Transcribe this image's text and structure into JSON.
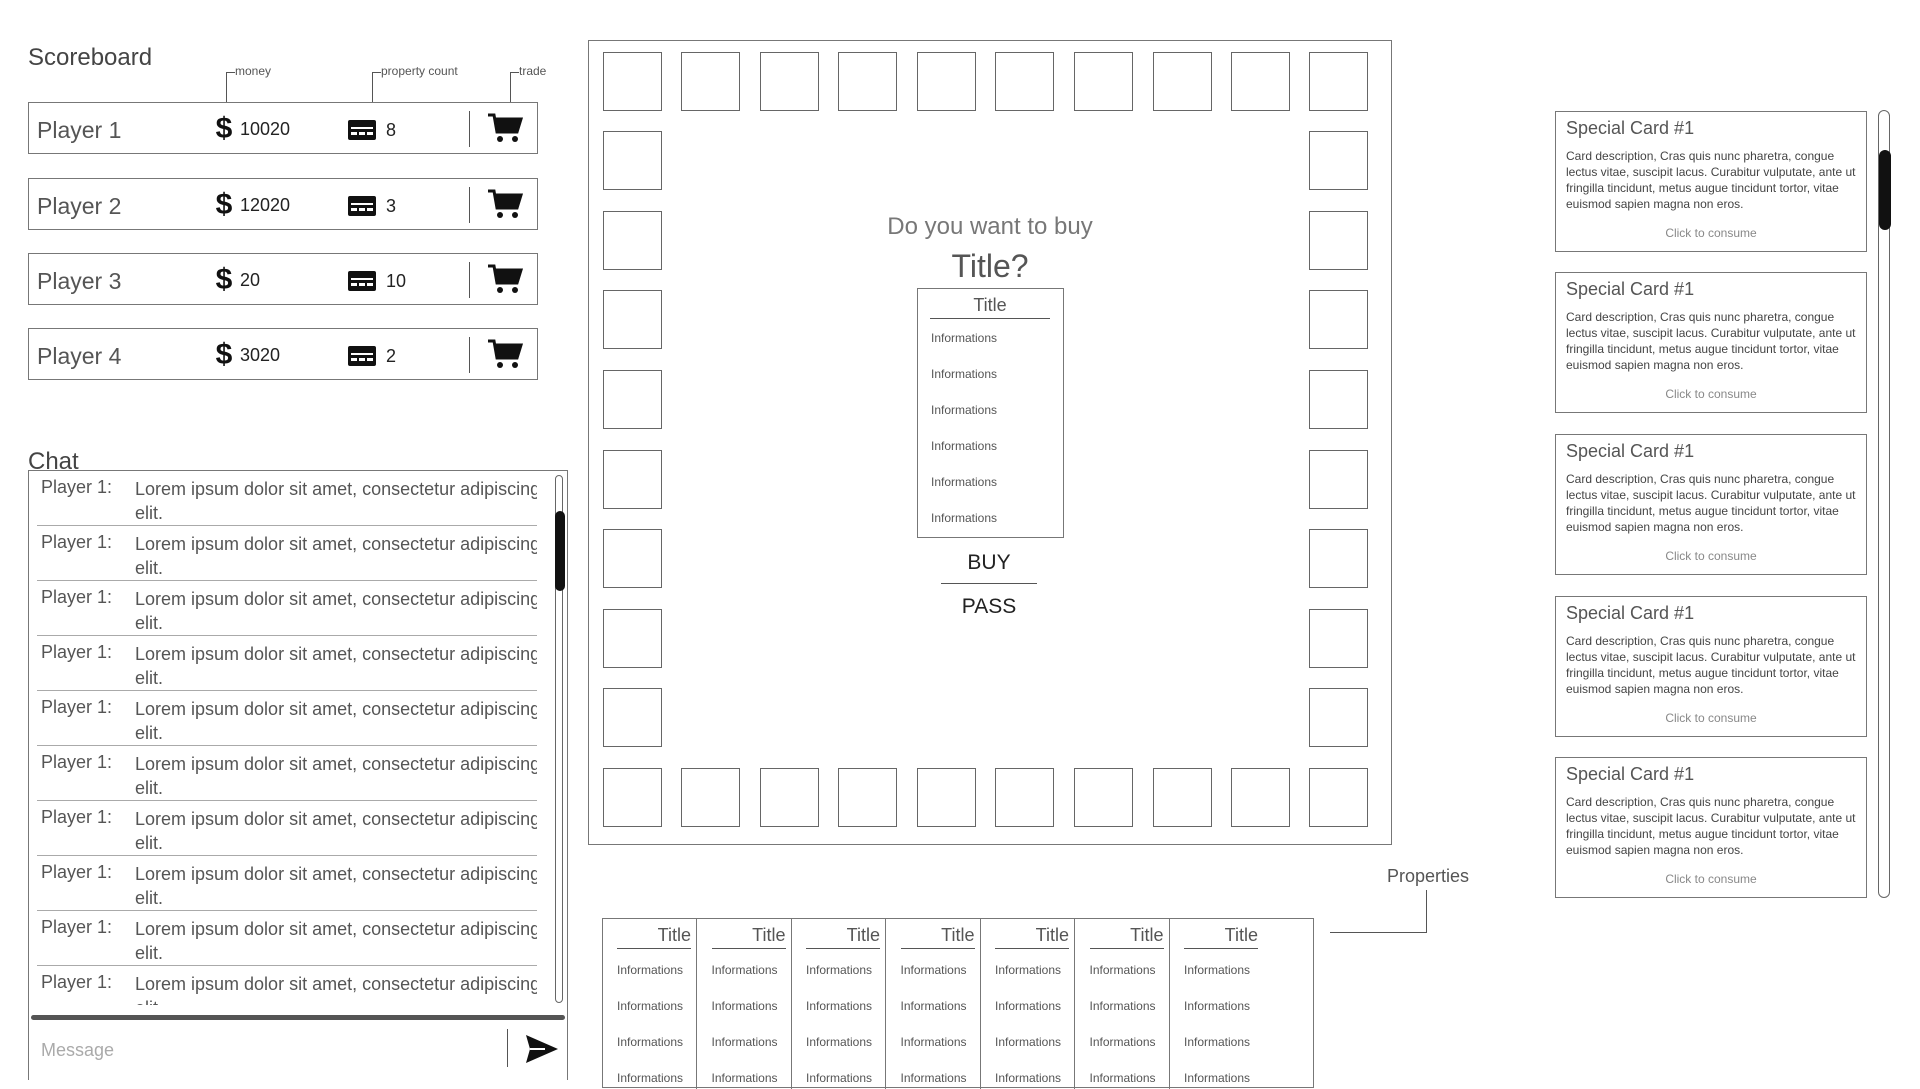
{
  "scoreboard": {
    "title": "Scoreboard",
    "annotations": {
      "money": "money",
      "property_count": "property count",
      "trade": "trade"
    },
    "players": [
      {
        "name": "Player 1",
        "money": "10020",
        "property_count": "8"
      },
      {
        "name": "Player 2",
        "money": "12020",
        "property_count": "3"
      },
      {
        "name": "Player 3",
        "money": "20",
        "property_count": "10"
      },
      {
        "name": "Player 4",
        "money": "3020",
        "property_count": "2"
      }
    ]
  },
  "chat": {
    "title": "Chat",
    "messages": [
      {
        "sender": "Player 1:",
        "text": "Lorem ipsum dolor sit amet, consectetur adipiscing elit."
      },
      {
        "sender": "Player 1:",
        "text": "Lorem ipsum dolor sit amet, consectetur adipiscing elit."
      },
      {
        "sender": "Player 1:",
        "text": "Lorem ipsum dolor sit amet, consectetur adipiscing elit."
      },
      {
        "sender": "Player 1:",
        "text": "Lorem ipsum dolor sit amet, consectetur adipiscing elit."
      },
      {
        "sender": "Player 1:",
        "text": "Lorem ipsum dolor sit amet, consectetur adipiscing elit."
      },
      {
        "sender": "Player 1:",
        "text": "Lorem ipsum dolor sit amet, consectetur adipiscing elit."
      },
      {
        "sender": "Player 1:",
        "text": "Lorem ipsum dolor sit amet, consectetur adipiscing elit."
      },
      {
        "sender": "Player 1:",
        "text": "Lorem ipsum dolor sit amet, consectetur adipiscing elit."
      },
      {
        "sender": "Player 1:",
        "text": "Lorem ipsum dolor sit amet, consectetur adipiscing elit."
      },
      {
        "sender": "Player 1:",
        "text": "Lorem ipsum dolor sit amet, consectetur adipiscing elit."
      }
    ],
    "message_placeholder": "Message",
    "message_value": ""
  },
  "board": {
    "prompt_question": "Do you want to buy",
    "prompt_title": "Title?",
    "property_card": {
      "title": "Title",
      "infos": [
        "Informations",
        "Informations",
        "Informations",
        "Informations",
        "Informations",
        "Informations"
      ]
    },
    "buy_label": "BUY",
    "pass_label": "PASS"
  },
  "properties": {
    "label": "Properties",
    "cards": [
      {
        "title": "Title",
        "infos": [
          "Informations",
          "Informations",
          "Informations",
          "Informations"
        ]
      },
      {
        "title": "Title",
        "infos": [
          "Informations",
          "Informations",
          "Informations",
          "Informations"
        ]
      },
      {
        "title": "Title",
        "infos": [
          "Informations",
          "Informations",
          "Informations",
          "Informations"
        ]
      },
      {
        "title": "Title",
        "infos": [
          "Informations",
          "Informations",
          "Informations",
          "Informations"
        ]
      },
      {
        "title": "Title",
        "infos": [
          "Informations",
          "Informations",
          "Informations",
          "Informations"
        ]
      },
      {
        "title": "Title",
        "infos": [
          "Informations",
          "Informations",
          "Informations",
          "Informations"
        ]
      },
      {
        "title": "Title",
        "infos": [
          "Informations",
          "Informations",
          "Informations",
          "Informations"
        ]
      }
    ]
  },
  "special_cards": [
    {
      "title": "Special Card #1",
      "description": "Card description, Cras quis nunc pharetra, congue lectus vitae, suscipit lacus. Curabitur vulputate, ante ut fringilla tincidunt, metus augue tincidunt tortor, vitae euismod sapien magna non eros.",
      "action": "Click to consume"
    },
    {
      "title": "Special Card #1",
      "description": "Card description, Cras quis nunc pharetra, congue lectus vitae, suscipit lacus. Curabitur vulputate, ante ut fringilla tincidunt, metus augue tincidunt tortor, vitae euismod sapien magna non eros.",
      "action": "Click to consume"
    },
    {
      "title": "Special Card #1",
      "description": "Card description, Cras quis nunc pharetra, congue lectus vitae, suscipit lacus. Curabitur vulputate, ante ut fringilla tincidunt, metus augue tincidunt tortor, vitae euismod sapien magna non eros.",
      "action": "Click to consume"
    },
    {
      "title": "Special Card #1",
      "description": "Card description, Cras quis nunc pharetra, congue lectus vitae, suscipit lacus. Curabitur vulputate, ante ut fringilla tincidunt, metus augue tincidunt tortor, vitae euismod sapien magna non eros.",
      "action": "Click to consume"
    },
    {
      "title": "Special Card #1",
      "description": "Card description, Cras quis nunc pharetra, congue lectus vitae, suscipit lacus. Curabitur vulputate, ante ut fringilla tincidunt, metus augue tincidunt tortor, vitae euismod sapien magna non eros.",
      "action": "Click to consume"
    }
  ],
  "icons": {
    "money": "dollar-icon",
    "property_count": "card-stack-icon",
    "trade": "cart-icon",
    "send": "send-icon"
  }
}
